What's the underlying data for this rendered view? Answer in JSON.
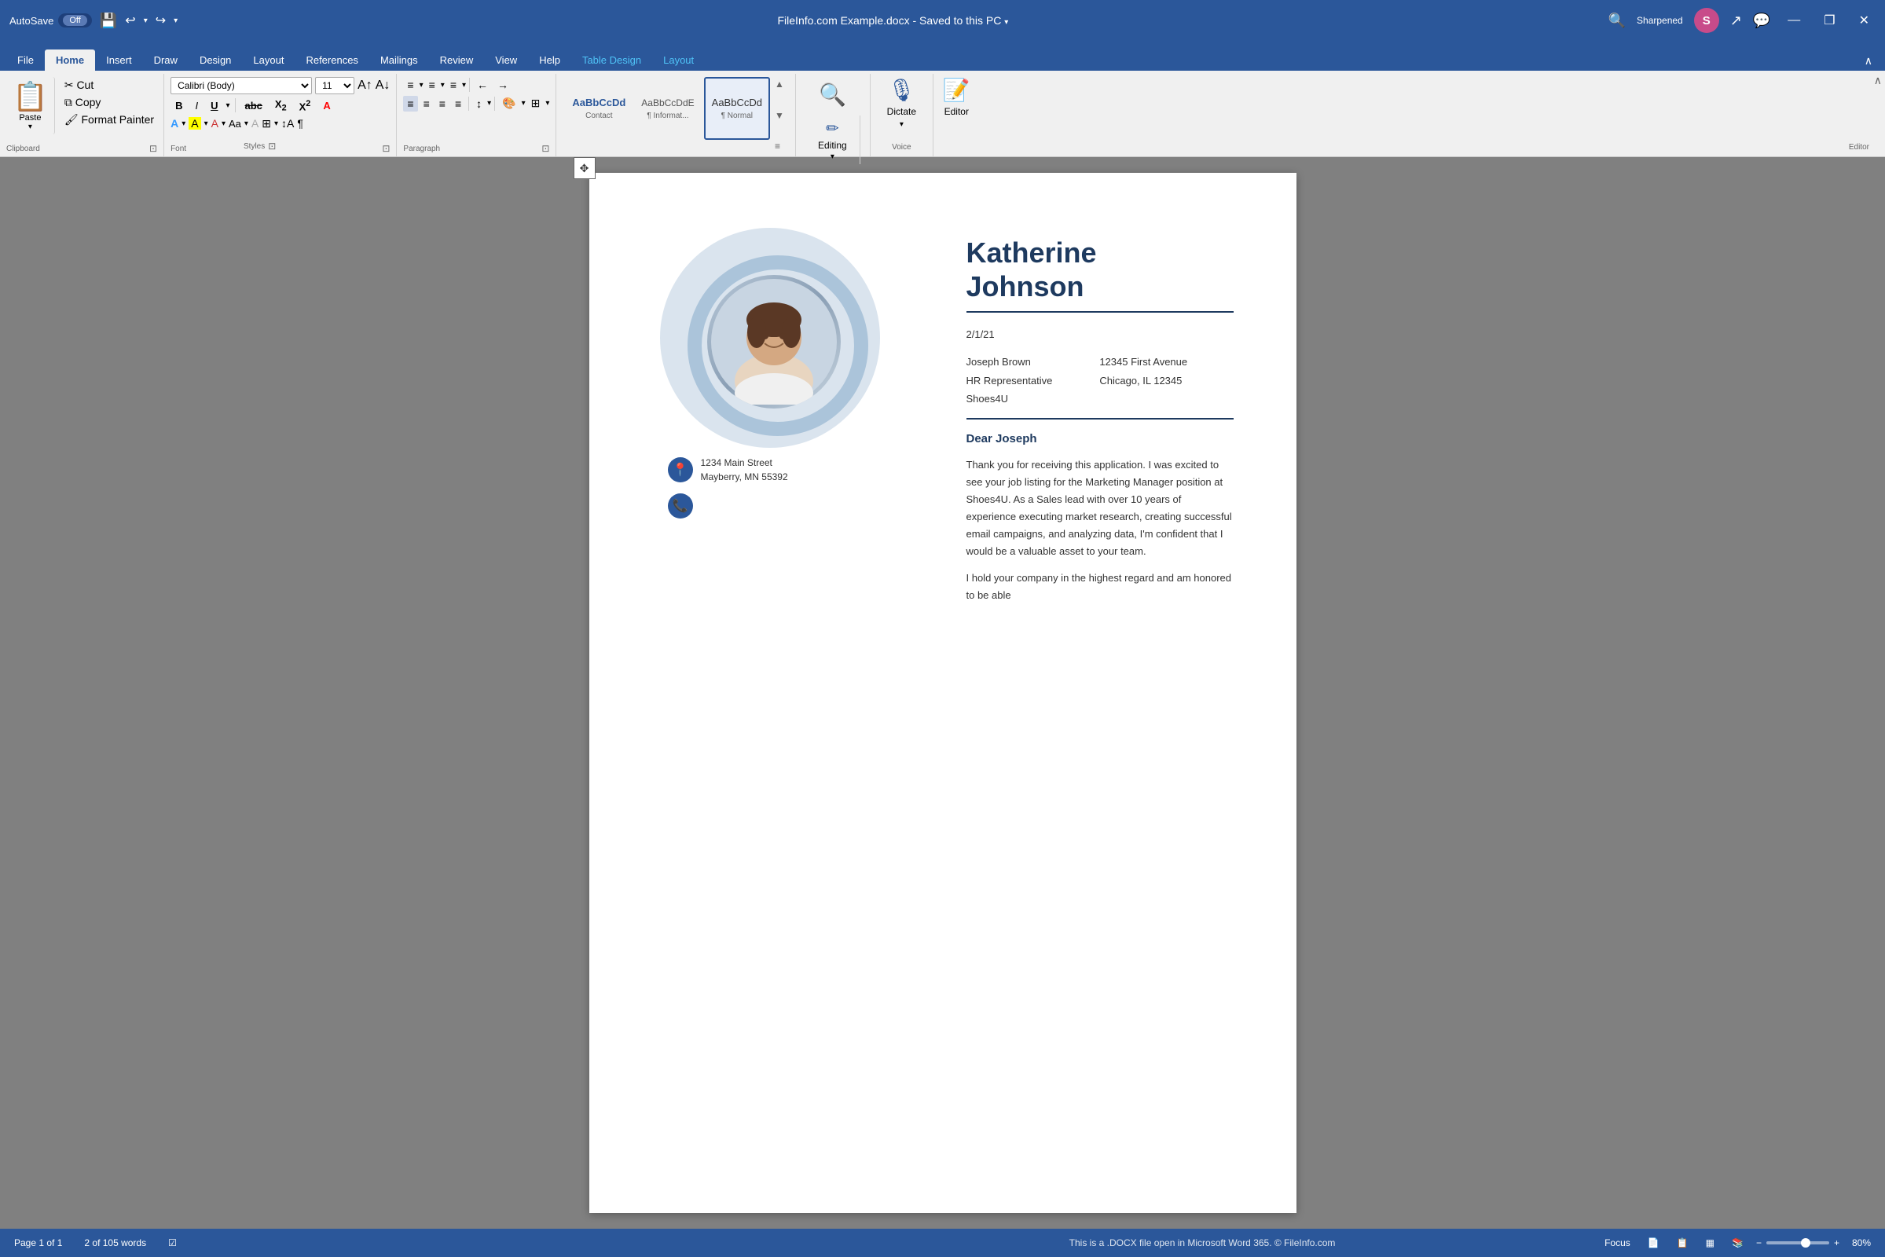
{
  "titlebar": {
    "autosave_label": "AutoSave",
    "toggle_label": "Off",
    "filename": "FileInfo.com Example.docx",
    "save_status": "Saved to this PC",
    "search_placeholder": "Search",
    "username": "Sharpened",
    "avatar_letter": "S",
    "minimize_icon": "—",
    "restore_icon": "❐",
    "close_icon": "✕",
    "share_icon": "↗",
    "comments_icon": "💬"
  },
  "ribbon_tabs": {
    "tabs": [
      {
        "label": "File",
        "active": false
      },
      {
        "label": "Home",
        "active": true
      },
      {
        "label": "Insert",
        "active": false
      },
      {
        "label": "Draw",
        "active": false
      },
      {
        "label": "Design",
        "active": false
      },
      {
        "label": "Layout",
        "active": false
      },
      {
        "label": "References",
        "active": false
      },
      {
        "label": "Mailings",
        "active": false
      },
      {
        "label": "Review",
        "active": false
      },
      {
        "label": "View",
        "active": false
      },
      {
        "label": "Help",
        "active": false
      },
      {
        "label": "Table Design",
        "active": false,
        "special": true
      },
      {
        "label": "Layout",
        "active": false,
        "special": true
      }
    ]
  },
  "ribbon": {
    "clipboard": {
      "paste_label": "Paste",
      "cut_label": "✂",
      "copy_label": "⧉",
      "format_painter_label": "🖌",
      "group_label": "Clipboard"
    },
    "font": {
      "font_name": "Calibri (Body)",
      "font_size": "11",
      "bold": "B",
      "italic": "I",
      "underline": "U",
      "strikethrough": "abc",
      "subscript": "X₂",
      "superscript": "X²",
      "clear": "A",
      "group_label": "Font"
    },
    "paragraph": {
      "bullets_label": "≡",
      "numbering_label": "≡",
      "multilevel_label": "≡",
      "decrease_indent": "←",
      "increase_indent": "→",
      "align_left": "≡",
      "align_center": "≡",
      "align_right": "≡",
      "justify": "≡",
      "spacing": "↕",
      "sort": "↕A",
      "show_para": "¶",
      "group_label": "Paragraph"
    },
    "styles": {
      "items": [
        {
          "preview": "AaBbCcDd",
          "label": "Contact"
        },
        {
          "preview": "AaBbCcDdE",
          "label": "¶ Informat..."
        },
        {
          "preview": "AaBbCcDd",
          "label": "¶ Normal",
          "selected": true
        }
      ],
      "group_label": "Styles"
    },
    "search": {
      "icon": "🔍",
      "label": ""
    },
    "editing": {
      "icon": "✏",
      "label": "Editing",
      "arrow": "▾"
    },
    "dictate": {
      "icon": "🎙",
      "label": "Dictate",
      "arrow": "▾"
    },
    "editor": {
      "icon": "📝",
      "label": "Editor"
    },
    "voice_group_label": "Voice",
    "editor_group_label": "Editor"
  },
  "document": {
    "move_handle": "✥",
    "person_name": "Katherine\nJohnson",
    "person_name_line1": "Katherine",
    "person_name_line2": "Johnson",
    "date": "2/1/21",
    "recipient_name": "Joseph Brown",
    "recipient_title": "HR Representative",
    "recipient_company": "Shoes4U",
    "recipient_address1": "12345 First Avenue",
    "recipient_address2": "Chicago, IL 12345",
    "salutation": "Dear Joseph",
    "body_p1": "Thank you for receiving this application.  I was excited to see your job listing for the Marketing Manager position at Shoes4U.  As a Sales lead with over 10 years of experience executing market research, creating successful email campaigns, and analyzing data, I'm confident that I would be a valuable asset to your team.",
    "body_p2": "I hold your company in the highest regard and am honored to be able",
    "address_line1": "1234 Main Street",
    "address_line2": "Mayberry, MN 55392"
  },
  "statusbar": {
    "page_info": "Page 1 of 1",
    "word_count": "2 of 105 words",
    "accessibility_icon": "☑",
    "notice": "This is a .DOCX file open in Microsoft Word 365. © FileInfo.com",
    "focus_label": "Focus",
    "view_icons": [
      "📄",
      "📋",
      "▦"
    ],
    "zoom_value": "80%"
  }
}
